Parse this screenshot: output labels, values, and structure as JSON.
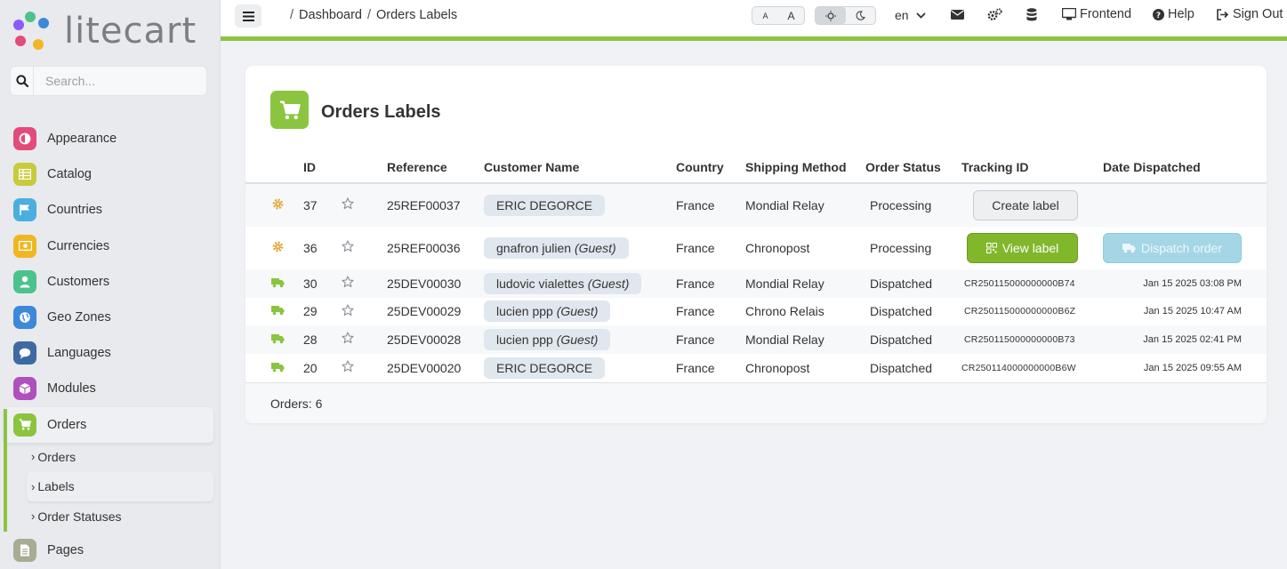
{
  "app": {
    "logo_text": "litecart"
  },
  "search": {
    "placeholder": "Search..."
  },
  "sidebar": {
    "items": [
      {
        "label": "Appearance",
        "icon": "appearance-icon",
        "color": "#e34b7a"
      },
      {
        "label": "Catalog",
        "icon": "catalog-icon",
        "color": "#c8cb3a"
      },
      {
        "label": "Countries",
        "icon": "flag-icon",
        "color": "#4aaee0"
      },
      {
        "label": "Currencies",
        "icon": "money-icon",
        "color": "#f1b722"
      },
      {
        "label": "Customers",
        "icon": "user-icon",
        "color": "#4cc28d"
      },
      {
        "label": "Geo Zones",
        "icon": "globe-icon",
        "color": "#3e88d9"
      },
      {
        "label": "Languages",
        "icon": "chat-icon",
        "color": "#3d6aa3"
      },
      {
        "label": "Modules",
        "icon": "cube-icon",
        "color": "#b04fbe"
      },
      {
        "label": "Orders",
        "icon": "cart-icon",
        "color": "#8bc53f"
      },
      {
        "label": "Pages",
        "icon": "document-icon",
        "color": "#a8ac94"
      }
    ],
    "orders_submenu": [
      "Orders",
      "Labels",
      "Order Statuses"
    ]
  },
  "topbar": {
    "breadcrumb": [
      "Dashboard",
      "Orders Labels"
    ],
    "font_small": "A",
    "font_large": "A",
    "language": "en",
    "frontend_label": "Frontend",
    "help_label": "Help",
    "signout_label": "Sign Out"
  },
  "page": {
    "title": "Orders Labels",
    "columns": [
      "ID",
      "Reference",
      "Customer Name",
      "Country",
      "Shipping Method",
      "Order Status",
      "Tracking ID",
      "Date Dispatched"
    ],
    "rows": [
      {
        "status_icon": "gear-icon",
        "id": "37",
        "reference": "25REF00037",
        "customer": "ERIC DEGORCE",
        "guest": "",
        "country": "France",
        "shipping": "Mondial Relay",
        "status": "Processing",
        "tracking": "",
        "date": "",
        "action": "Create label"
      },
      {
        "status_icon": "gear-icon",
        "id": "36",
        "reference": "25REF00036",
        "customer": "gnafron julien",
        "guest": "(Guest)",
        "country": "France",
        "shipping": "Chronopost",
        "status": "Processing",
        "tracking": "",
        "date": "",
        "action_view": "View label",
        "action_dispatch": "Dispatch order"
      },
      {
        "status_icon": "truck-icon",
        "id": "30",
        "reference": "25DEV00030",
        "customer": "ludovic vialettes",
        "guest": "(Guest)",
        "country": "France",
        "shipping": "Mondial Relay",
        "status": "Dispatched",
        "tracking": "CR250115000000000B74",
        "date": "Jan 15 2025 03:08 PM"
      },
      {
        "status_icon": "truck-icon",
        "id": "29",
        "reference": "25DEV00029",
        "customer": "lucien ppp",
        "guest": "(Guest)",
        "country": "France",
        "shipping": "Chrono Relais",
        "status": "Dispatched",
        "tracking": "CR250115000000000B6Z",
        "date": "Jan 15 2025 10:47 AM"
      },
      {
        "status_icon": "truck-icon",
        "id": "28",
        "reference": "25DEV00028",
        "customer": "lucien ppp",
        "guest": "(Guest)",
        "country": "France",
        "shipping": "Mondial Relay",
        "status": "Dispatched",
        "tracking": "CR250115000000000B73",
        "date": "Jan 15 2025 02:41 PM"
      },
      {
        "status_icon": "truck-icon",
        "id": "20",
        "reference": "25DEV00020",
        "customer": "ERIC DEGORCE",
        "guest": "",
        "country": "France",
        "shipping": "Chronopost",
        "status": "Dispatched",
        "tracking": "CR250114000000000B6W",
        "date": "Jan 15 2025 09:55 AM"
      }
    ],
    "footer": "Orders: 6"
  },
  "colors": {
    "accent": "#8bc53f",
    "gear": "#e5a83a",
    "truck": "#8bc53f"
  }
}
